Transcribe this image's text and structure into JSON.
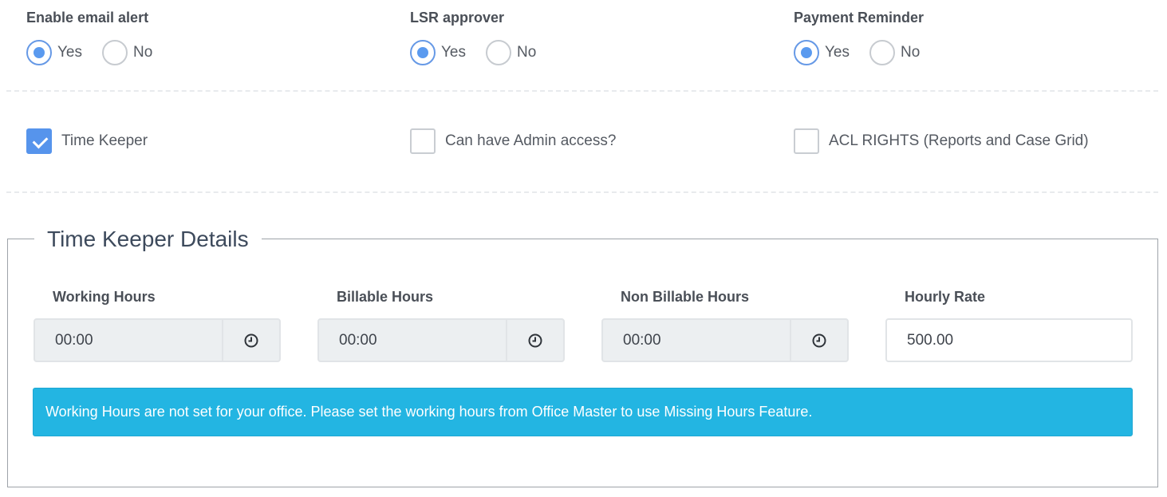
{
  "radio_groups": [
    {
      "label": "Enable email alert",
      "options": [
        "Yes",
        "No"
      ],
      "selected": "Yes"
    },
    {
      "label": "LSR approver",
      "options": [
        "Yes",
        "No"
      ],
      "selected": "Yes"
    },
    {
      "label": "Payment Reminder",
      "options": [
        "Yes",
        "No"
      ],
      "selected": "Yes"
    }
  ],
  "checkboxes": [
    {
      "label": "Time Keeper",
      "checked": true
    },
    {
      "label": "Can have Admin access?",
      "checked": false
    },
    {
      "label": "ACL RIGHTS (Reports and Case Grid)",
      "checked": false
    }
  ],
  "time_keeper_details": {
    "legend": "Time Keeper Details",
    "fields": [
      {
        "label": "Working Hours",
        "value": "00:00",
        "icon": "clock-icon"
      },
      {
        "label": "Billable Hours",
        "value": "00:00",
        "icon": "clock-icon"
      },
      {
        "label": "Non Billable Hours",
        "value": "00:00",
        "icon": "clock-icon"
      },
      {
        "label": "Hourly Rate",
        "value": "500.00"
      }
    ],
    "alert": "Working Hours are not set for your office. Please set the working hours from Office Master to use Missing Hours Feature."
  },
  "colors": {
    "accent": "#5a9aef",
    "alert_bg": "#23b5e2"
  }
}
